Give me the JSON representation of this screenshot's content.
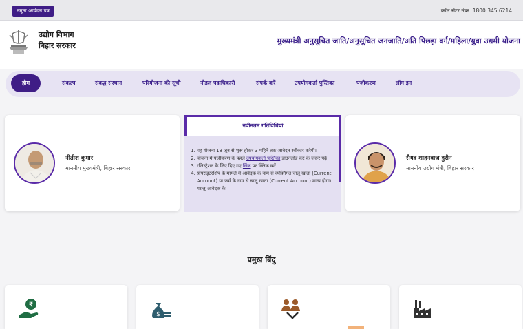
{
  "topbar": {
    "sample_form": "नमूना आवेदन पत्र",
    "call_center": "कॉल सेंटर नंबर: 1800 345 6214"
  },
  "header": {
    "dept_line1": "उद्योग विभाग",
    "dept_line2": "बिहार सरकार",
    "scheme_title": "मुख्यमंत्री अनुसूचित जाति/अनुसूचित जनजाति/अति पिछड़ा वर्ग/महिला/युवा उद्यमी योजना"
  },
  "nav": {
    "items": [
      "होम",
      "संकल्प",
      "संबद्ध संस्थान",
      "परियोजना की सूची",
      "नोडल पदाधिकारी",
      "संपर्क करें",
      "उपयोगकर्ता पुस्तिका",
      "पंजीकरण",
      "लॉग इन"
    ]
  },
  "leaders": {
    "left": {
      "name": "नीतीश कुमार",
      "role": "माननीय मुख्यमंत्री, बिहार सरकार"
    },
    "right": {
      "name": "सैयद शाहनवाज हुसैन",
      "role": "माननीय उद्योग मंत्री, बिहार सरकार"
    }
  },
  "activities": {
    "title": "नवीनतम गतिविधियां",
    "item1": "यह योजना 18 जून से शुरू होकर 3 महिने तक आवेदन स्वीकार करेगी।",
    "item2_pre": "योजना में पंजीकरण के पहले ",
    "item2_link": "उपयोगकर्ता पुस्तिका",
    "item2_post": " डाउनलोड कर के जरूर पढ़े",
    "item3_pre": "रजिस्ट्रेशन के लिए दिए गए ",
    "item3_link": "लिंक",
    "item3_post": " पर क्लिक करें",
    "item4": "प्रोपराइटरशिप के मामले में आवेदक के नाम से व्यक्तिगत चालू खाता (Current Account) या फर्म के नाम से चालू खाता (Current Account) मान्य होगा। परन्तु आवेदक के"
  },
  "section": {
    "title": "प्रमुख बिंदु"
  },
  "colors": {
    "primary": "#3f1d86",
    "nav_bg": "#e7e3f3",
    "icon_green": "#1f6d43",
    "icon_teal": "#2e5d6e"
  },
  "feature_icons": [
    "rupee-hand-icon",
    "money-bag-icon",
    "handshake-people-icon",
    "factory-icon"
  ]
}
